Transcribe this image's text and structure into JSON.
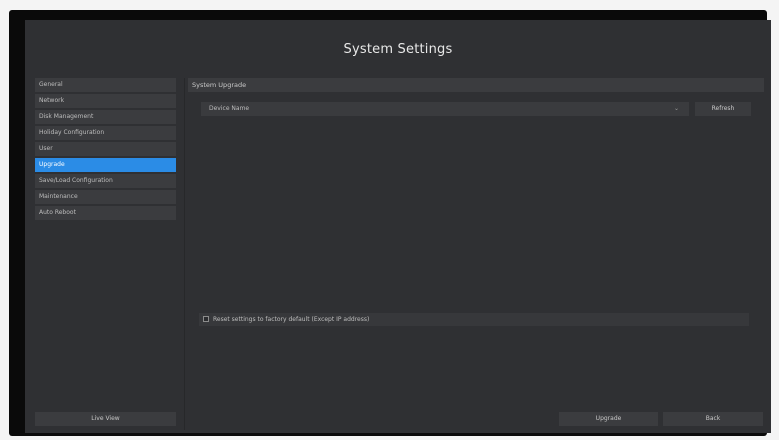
{
  "window": {
    "title": "System Settings"
  },
  "sidebar": {
    "items": [
      {
        "label": "General",
        "active": false
      },
      {
        "label": "Network",
        "active": false
      },
      {
        "label": "Disk Management",
        "active": false
      },
      {
        "label": "Holiday Configuration",
        "active": false
      },
      {
        "label": "User",
        "active": false
      },
      {
        "label": "Upgrade",
        "active": true
      },
      {
        "label": "Save/Load Configuration",
        "active": false
      },
      {
        "label": "Maintenance",
        "active": false
      },
      {
        "label": "Auto Reboot",
        "active": false
      }
    ],
    "live_view_label": "Live View"
  },
  "main": {
    "section_title": "System Upgrade",
    "device_select": {
      "value": "Device Name",
      "chevron_icon": "chevron-down-icon"
    },
    "refresh_label": "Refresh",
    "reset_checkbox": {
      "label": "Reset settings to factory default (Except IP address)",
      "checked": false
    }
  },
  "footer": {
    "upgrade_label": "Upgrade",
    "back_label": "Back"
  },
  "colors": {
    "background": "#2f3033",
    "panel": "#3b3c3f",
    "accent": "#2b8ce6"
  }
}
